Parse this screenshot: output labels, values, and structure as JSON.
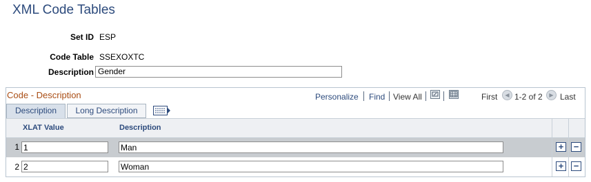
{
  "page": {
    "title": "XML Code Tables",
    "setid_label": "Set ID",
    "setid_value": "ESP",
    "codetable_label": "Code Table",
    "codetable_value": "SSEXOXTC",
    "description_label": "Description",
    "description_value": "Gender"
  },
  "grid": {
    "title": "Code - Description",
    "personalize": "Personalize",
    "find": "Find",
    "view_all": "View All",
    "first": "First",
    "range": "1-2 of 2",
    "last": "Last",
    "tabs": [
      "Description",
      "Long Description"
    ],
    "columns": [
      "XLAT Value",
      "Description"
    ],
    "rows": [
      {
        "num": "1",
        "xlat": "1",
        "description": "Man"
      },
      {
        "num": "2",
        "xlat": "2",
        "description": "Woman"
      }
    ]
  },
  "colors": {
    "title_blue": "#2c4a7c",
    "grid_title_orange": "#a94d14",
    "selected_row_gray": "#c8ccd0"
  }
}
